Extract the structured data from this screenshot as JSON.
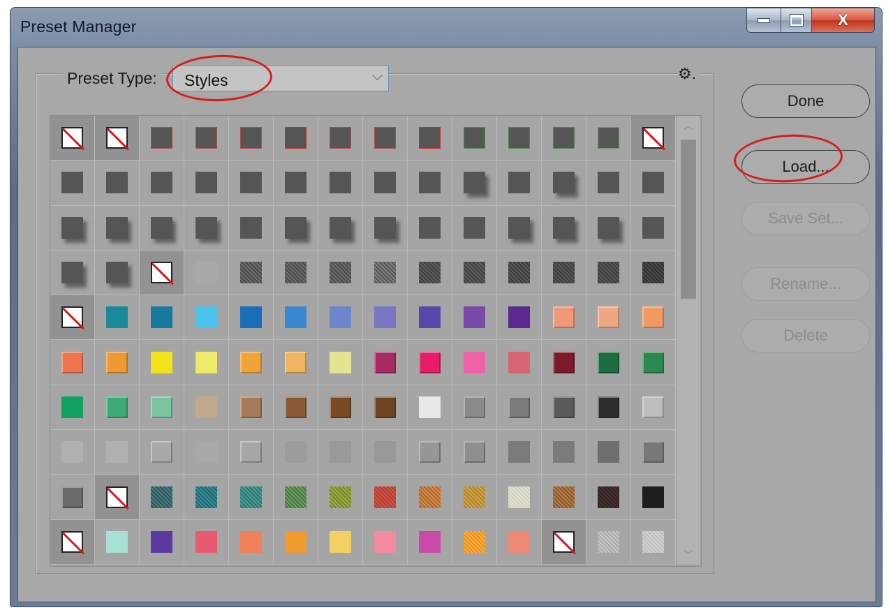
{
  "window": {
    "title": "Preset Manager"
  },
  "caption_buttons": {
    "close_glyph": "X",
    "minimize_icon": "minimize-icon",
    "maximize_icon": "maximize-icon"
  },
  "preset": {
    "label": "Preset Type:",
    "selected": "Styles",
    "options_icon": "gear-icon",
    "gear_glyph": "⚙."
  },
  "buttons": {
    "done": "Done",
    "load": "Load...",
    "save_set": "Save Set...",
    "rename": "Rename...",
    "delete": "Delete"
  },
  "scroll": {
    "up_glyph": "︿",
    "down_glyph": "﹀",
    "thumb_position": 0.0
  },
  "colors": {
    "highlight_ring": "#d61d1d",
    "none_slash": "#d21a1a",
    "dialog_bg": "#a8a8a8"
  },
  "swatches": [
    [
      {
        "c": "none"
      },
      {
        "c": "none"
      },
      {
        "c": "#555555",
        "b": "#b04a4a"
      },
      {
        "c": "#555555",
        "b": "#b04a4a"
      },
      {
        "c": "#555555",
        "b": "#b04a4a"
      },
      {
        "c": "#555555",
        "b": "#d02a2a"
      },
      {
        "c": "#555555",
        "b": "#b04a4a"
      },
      {
        "c": "#555555",
        "b": "#b04a4a"
      },
      {
        "c": "#555555",
        "b": "#d02a2a"
      },
      {
        "c": "#555555",
        "b": "#4c8a4c"
      },
      {
        "c": "#555555",
        "b": "#4c8a4c"
      },
      {
        "c": "#555555",
        "b": "#4c8a4c"
      },
      {
        "c": "#555555",
        "b": "#6a9a6a"
      },
      {
        "c": "none"
      }
    ],
    [
      {
        "c": "#555555"
      },
      {
        "c": "#555555"
      },
      {
        "c": "#555555"
      },
      {
        "c": "#555555"
      },
      {
        "c": "#555555"
      },
      {
        "c": "#555555"
      },
      {
        "c": "#555555"
      },
      {
        "c": "#555555"
      },
      {
        "c": "#555555"
      },
      {
        "c": "#555555",
        "fx": "shadow"
      },
      {
        "c": "#555555"
      },
      {
        "c": "#555555",
        "fx": "shadow"
      },
      {
        "c": "#555555"
      },
      {
        "c": "#555555"
      }
    ],
    [
      {
        "c": "#555555",
        "fx": "shadow"
      },
      {
        "c": "#555555",
        "fx": "shadow"
      },
      {
        "c": "#555555",
        "fx": "shadow"
      },
      {
        "c": "#555555",
        "fx": "shadow"
      },
      {
        "c": "#555555"
      },
      {
        "c": "#555555",
        "fx": "shadow"
      },
      {
        "c": "#555555",
        "fx": "shadow"
      },
      {
        "c": "#555555",
        "fx": "shadow"
      },
      {
        "c": "#555555"
      },
      {
        "c": "#555555"
      },
      {
        "c": "#555555",
        "fx": "shadow"
      },
      {
        "c": "#555555",
        "fx": "shadow"
      },
      {
        "c": "#555555",
        "fx": "shadow"
      },
      {
        "c": "#555555"
      }
    ],
    [
      {
        "c": "#555555",
        "fx": "shadow"
      },
      {
        "c": "#555555",
        "fx": "shadow"
      },
      {
        "c": "none"
      },
      {
        "c": "#a9a9a9"
      },
      {
        "c": "#5c5c5c",
        "fx": "tex"
      },
      {
        "c": "#5c5c5c",
        "fx": "tex"
      },
      {
        "c": "#5c5c5c",
        "fx": "tex"
      },
      {
        "c": "#6a6a6a",
        "fx": "tex"
      },
      {
        "c": "#4e4e4e",
        "fx": "tex"
      },
      {
        "c": "#4e4e4e",
        "fx": "tex"
      },
      {
        "c": "#4a4a4a",
        "fx": "tex"
      },
      {
        "c": "#4a4a4a",
        "fx": "tex"
      },
      {
        "c": "#4a4a4a",
        "fx": "tex"
      },
      {
        "c": "#3e3e3e",
        "fx": "tex"
      }
    ],
    [
      {
        "c": "none"
      },
      {
        "c": "#1a8a9a"
      },
      {
        "c": "#187a9e"
      },
      {
        "c": "#4cc4ee"
      },
      {
        "c": "#1a6eb8"
      },
      {
        "c": "#3a86cf"
      },
      {
        "c": "#6e86cc"
      },
      {
        "c": "#7a76c4"
      },
      {
        "c": "#5648a8"
      },
      {
        "c": "#7a4aa8"
      },
      {
        "c": "#5c2a8e"
      },
      {
        "c": "#f09878",
        "fx": "bevel"
      },
      {
        "c": "#f0a882",
        "fx": "bevel"
      },
      {
        "c": "#f09a62",
        "fx": "bevel"
      }
    ],
    [
      {
        "c": "#ee7450",
        "fx": "bevel"
      },
      {
        "c": "#f09832",
        "fx": "bevel"
      },
      {
        "c": "#f2e21a"
      },
      {
        "c": "#eeea6a"
      },
      {
        "c": "#f0a438",
        "fx": "bevel"
      },
      {
        "c": "#f0b460",
        "fx": "bevel"
      },
      {
        "c": "#e2e490"
      },
      {
        "c": "#a82a62",
        "fx": "bevel"
      },
      {
        "c": "#e81c68",
        "fx": "bevel"
      },
      {
        "c": "#ee62aa"
      },
      {
        "c": "#d86472"
      },
      {
        "c": "#7e1a2a",
        "fx": "bevel"
      },
      {
        "c": "#1a6e40",
        "fx": "bevel"
      },
      {
        "c": "#2a8a4e",
        "fx": "bevel"
      }
    ],
    [
      {
        "c": "#10a060"
      },
      {
        "c": "#3eaa76",
        "fx": "bevel"
      },
      {
        "c": "#7ac4a0",
        "fx": "bevel"
      },
      {
        "c": "#c0a88a"
      },
      {
        "c": "#a67c58",
        "fx": "bevel"
      },
      {
        "c": "#8a5a34",
        "fx": "bevel"
      },
      {
        "c": "#7a4a24",
        "fx": "bevel"
      },
      {
        "c": "#6e4422",
        "fx": "bevel"
      },
      {
        "c": "#e8e8e8"
      },
      {
        "c": "#8a8a8a",
        "fx": "bevel"
      },
      {
        "c": "#7a7a7a",
        "fx": "bevel"
      },
      {
        "c": "#5a5a5a",
        "fx": "bevel"
      },
      {
        "c": "#2e2e2e",
        "fx": "bevel"
      },
      {
        "c": "#bdbdbd",
        "fx": "bevel"
      }
    ],
    [
      {
        "c": "#b0b0b0"
      },
      {
        "c": "#b0b0b0"
      },
      {
        "c": "#a9a9a9",
        "fx": "bevel"
      },
      {
        "c": "#a9a9a9"
      },
      {
        "c": "#a6a6a6",
        "fx": "bevel"
      },
      {
        "c": "#9c9c9c"
      },
      {
        "c": "#9a9a9a"
      },
      {
        "c": "#999999"
      },
      {
        "c": "#969696",
        "fx": "bevel"
      },
      {
        "c": "#8e8e8e",
        "fx": "bevel"
      },
      {
        "c": "#7a7a7a"
      },
      {
        "c": "#7a7a7a"
      },
      {
        "c": "#6e6e6e"
      },
      {
        "c": "#787878",
        "fx": "bevel"
      }
    ],
    [
      {
        "c": "#6a6a6a",
        "fx": "bevel"
      },
      {
        "c": "none"
      },
      {
        "c": "#3a6a6e",
        "fx": "tex"
      },
      {
        "c": "#2a7a82",
        "fx": "tex"
      },
      {
        "c": "#3a8a82",
        "fx": "tex"
      },
      {
        "c": "#5a8a52",
        "fx": "tex"
      },
      {
        "c": "#8a9a3a",
        "fx": "tex"
      },
      {
        "c": "#c04a3a",
        "fx": "tex"
      },
      {
        "c": "#c07a3a",
        "fx": "tex"
      },
      {
        "c": "#c0943a",
        "fx": "tex"
      },
      {
        "c": "#d8d8c8",
        "fx": "tex"
      },
      {
        "c": "#a06a3a",
        "fx": "tex"
      },
      {
        "c": "#3a2a2a",
        "fx": "tex"
      },
      {
        "c": "#1e1e1e",
        "fx": "tex"
      }
    ],
    [
      {
        "c": "none"
      },
      {
        "c": "#a8e0d4"
      },
      {
        "c": "#5a3aa0"
      },
      {
        "c": "#e85a70"
      },
      {
        "c": "#f0805a"
      },
      {
        "c": "#f09a30"
      },
      {
        "c": "#f2d062"
      },
      {
        "c": "#f28aa0"
      },
      {
        "c": "#c84aa8"
      },
      {
        "c": "#f0a030",
        "fx": "tex"
      },
      {
        "c": "#f08a78"
      },
      {
        "c": "none"
      },
      {
        "c": "#b8b8b8",
        "fx": "tex"
      },
      {
        "c": "#c8c8c8",
        "fx": "tex"
      }
    ]
  ]
}
